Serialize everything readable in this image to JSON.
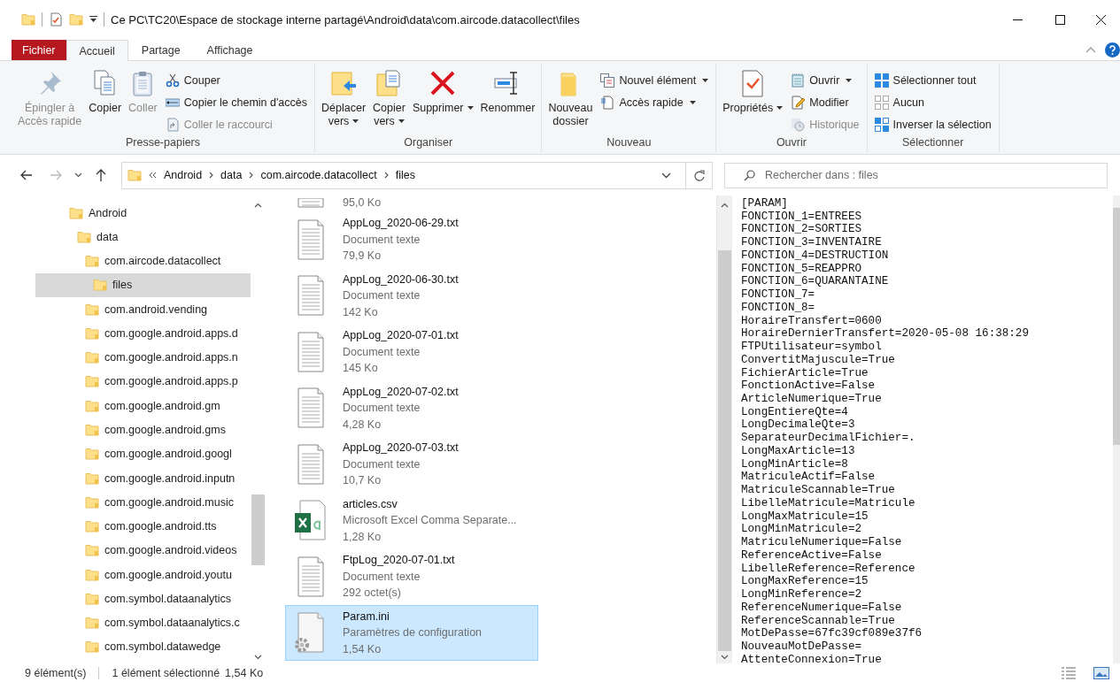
{
  "window": {
    "title": "Ce PC\\TC20\\Espace de stockage interne partagé\\Android\\data\\com.aircode.datacollect\\files"
  },
  "ribbon": {
    "tabs": [
      {
        "label": "Fichier",
        "kind": "file",
        "selected": false
      },
      {
        "label": "Accueil",
        "kind": "tab",
        "selected": true
      },
      {
        "label": "Partage",
        "kind": "tab",
        "selected": false
      },
      {
        "label": "Affichage",
        "kind": "tab",
        "selected": false
      }
    ],
    "groups": [
      {
        "label": "Presse-papiers",
        "items": [
          {
            "label": "Épingler à\nAccès rapide",
            "kind": "large",
            "disabled": true,
            "dropdown": false
          },
          {
            "label": "Copier",
            "kind": "large",
            "disabled": false,
            "dropdown": false
          },
          {
            "label": "Coller",
            "kind": "large",
            "disabled": true,
            "dropdown": false
          },
          {
            "label": "Couper",
            "kind": "small",
            "disabled": false,
            "dropdown": false
          },
          {
            "label": "Copier le chemin d'accès",
            "kind": "small",
            "disabled": false,
            "dropdown": false
          },
          {
            "label": "Coller le raccourci",
            "kind": "small",
            "disabled": true,
            "dropdown": false
          }
        ]
      },
      {
        "label": "Organiser",
        "items": [
          {
            "label": "Déplacer\nvers",
            "kind": "large",
            "disabled": false,
            "dropdown": true
          },
          {
            "label": "Copier\nvers",
            "kind": "large",
            "disabled": false,
            "dropdown": true
          },
          {
            "label": "Supprimer",
            "kind": "large",
            "disabled": false,
            "dropdown": true
          },
          {
            "label": "Renommer",
            "kind": "large",
            "disabled": false,
            "dropdown": false
          }
        ]
      },
      {
        "label": "Nouveau",
        "items": [
          {
            "label": "Nouveau\ndossier",
            "kind": "large",
            "disabled": false,
            "dropdown": false
          },
          {
            "label": "Nouvel élément",
            "kind": "small",
            "disabled": false,
            "dropdown": true
          },
          {
            "label": "Accès rapide",
            "kind": "small",
            "disabled": false,
            "dropdown": true
          }
        ]
      },
      {
        "label": "Ouvrir",
        "items": [
          {
            "label": "Propriétés",
            "kind": "large",
            "disabled": false,
            "dropdown": true
          },
          {
            "label": "Ouvrir",
            "kind": "small",
            "disabled": false,
            "dropdown": true
          },
          {
            "label": "Modifier",
            "kind": "small",
            "disabled": false,
            "dropdown": false
          },
          {
            "label": "Historique",
            "kind": "small",
            "disabled": true,
            "dropdown": false
          }
        ]
      },
      {
        "label": "Sélectionner",
        "items": [
          {
            "label": "Sélectionner tout",
            "kind": "small",
            "disabled": false,
            "dropdown": false
          },
          {
            "label": "Aucun",
            "kind": "small",
            "disabled": false,
            "dropdown": false
          },
          {
            "label": "Inverser la sélection",
            "kind": "small",
            "disabled": false,
            "dropdown": false
          }
        ]
      }
    ]
  },
  "navigation": {
    "back": {
      "disabled": false
    },
    "forward": {
      "disabled": true
    }
  },
  "address": {
    "crumbs": [
      "Android",
      "data",
      "com.aircode.datacollect",
      "files"
    ]
  },
  "search": {
    "placeholder": "Rechercher dans : files"
  },
  "nav_tree": [
    {
      "label": "Android",
      "selected": false,
      "children": [
        {
          "label": "data",
          "selected": false,
          "children": [
            {
              "label": "com.aircode.datacollect",
              "selected": false,
              "children": [
                {
                  "label": "files",
                  "selected": true
                }
              ]
            },
            {
              "label": "com.android.vending",
              "selected": false
            },
            {
              "label": "com.google.android.apps.d",
              "selected": false
            },
            {
              "label": "com.google.android.apps.n",
              "selected": false
            },
            {
              "label": "com.google.android.apps.p",
              "selected": false
            },
            {
              "label": "com.google.android.gm",
              "selected": false
            },
            {
              "label": "com.google.android.gms",
              "selected": false
            },
            {
              "label": "com.google.android.googl",
              "selected": false
            },
            {
              "label": "com.google.android.inputn",
              "selected": false
            },
            {
              "label": "com.google.android.music",
              "selected": false
            },
            {
              "label": "com.google.android.tts",
              "selected": false
            },
            {
              "label": "com.google.android.videos",
              "selected": false
            },
            {
              "label": "com.google.android.youtu",
              "selected": false
            },
            {
              "label": "com.symbol.dataanalytics",
              "selected": false
            },
            {
              "label": "com.symbol.dataanalytics.c",
              "selected": false
            },
            {
              "label": "com.symbol.datawedge",
              "selected": false
            }
          ]
        }
      ]
    }
  ],
  "files": [
    {
      "kind": "text",
      "size": "95,0 Ko",
      "selected": false
    },
    {
      "kind": "text",
      "name": "AppLog_2020-06-29.txt",
      "type": "Document texte",
      "size": "79,9 Ko",
      "selected": false
    },
    {
      "kind": "text",
      "name": "AppLog_2020-06-30.txt",
      "type": "Document texte",
      "size": "142 Ko",
      "selected": false
    },
    {
      "kind": "text",
      "name": "AppLog_2020-07-01.txt",
      "type": "Document texte",
      "size": "145 Ko",
      "selected": false
    },
    {
      "kind": "text",
      "name": "AppLog_2020-07-02.txt",
      "type": "Document texte",
      "size": "4,28 Ko",
      "selected": false
    },
    {
      "kind": "text",
      "name": "AppLog_2020-07-03.txt",
      "type": "Document texte",
      "size": "10,7 Ko",
      "selected": false
    },
    {
      "kind": "spreadsheet",
      "name": "articles.csv",
      "type": "Microsoft Excel Comma Separate...",
      "size": "1,28 Ko",
      "selected": false
    },
    {
      "kind": "text",
      "name": "FtpLog_2020-07-01.txt",
      "type": "Document texte",
      "size": "292 octet(s)",
      "selected": false
    },
    {
      "kind": "settings",
      "name": "Param.ini",
      "type": "Paramètres de configuration",
      "size": "1,54 Ko",
      "selected": true
    }
  ],
  "preview": {
    "lines": [
      "[PARAM]",
      "FONCTION_1=ENTREES",
      "FONCTION_2=SORTIES",
      "FONCTION_3=INVENTAIRE",
      "FONCTION_4=DESTRUCTION",
      "FONCTION_5=REAPPRO",
      "FONCTION_6=QUARANTAINE",
      "FONCTION_7=",
      "FONCTION_8=",
      "HoraireTransfert=0600",
      "HoraireDernierTransfert=2020-05-08 16:38:29",
      "FTPUtilisateur=symbol",
      "ConvertitMajuscule=True",
      "FichierArticle=True",
      "FonctionActive=False",
      "ArticleNumerique=True",
      "LongEntiereQte=4",
      "LongDecimaleQte=3",
      "SeparateurDecimalFichier=.",
      "LongMaxArticle=13",
      "LongMinArticle=8",
      "MatriculeActif=False",
      "MatriculeScannable=True",
      "LibelleMatricule=Matricule",
      "LongMaxMatricule=15",
      "LongMinMatricule=2",
      "MatriculeNumerique=False",
      "ReferenceActive=False",
      "LibelleReference=Reference",
      "LongMaxReference=15",
      "LongMinReference=2",
      "ReferenceNumerique=False",
      "ReferenceScannable=True",
      "MotDePasse=67fc39cf089e37f6",
      "NouveauMotDePasse=",
      "AttenteConnexion=True"
    ]
  },
  "status_bar": {
    "count": "9 élément(s)",
    "selection": "1 élément sélectionné",
    "size": "1,54 Ko"
  }
}
